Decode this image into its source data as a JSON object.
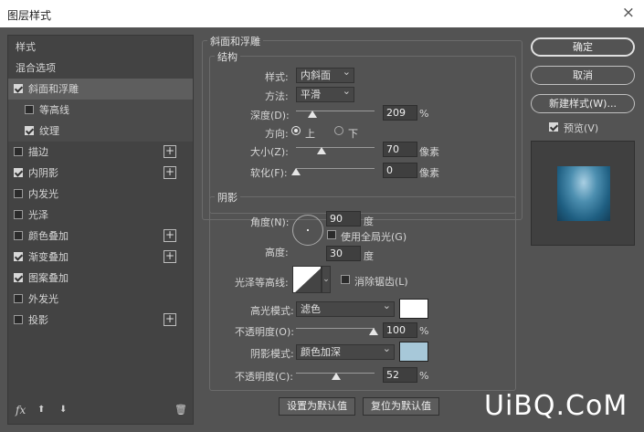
{
  "window": {
    "title": "图层样式",
    "close_glyph": "×"
  },
  "sidebar": {
    "items": [
      {
        "label": "样式",
        "checkbox": false,
        "checked": false,
        "plus": false,
        "indent": 0
      },
      {
        "label": "混合选项",
        "checkbox": false,
        "checked": false,
        "plus": false,
        "indent": 0
      },
      {
        "label": "斜面和浮雕",
        "checkbox": true,
        "checked": true,
        "plus": false,
        "indent": 0,
        "selected": true
      },
      {
        "label": "等高线",
        "checkbox": true,
        "checked": false,
        "plus": false,
        "indent": 1
      },
      {
        "label": "纹理",
        "checkbox": true,
        "checked": true,
        "plus": false,
        "indent": 1
      },
      {
        "label": "描边",
        "checkbox": true,
        "checked": false,
        "plus": true,
        "indent": 0
      },
      {
        "label": "内阴影",
        "checkbox": true,
        "checked": true,
        "plus": true,
        "indent": 0
      },
      {
        "label": "内发光",
        "checkbox": true,
        "checked": false,
        "plus": false,
        "indent": 0
      },
      {
        "label": "光泽",
        "checkbox": true,
        "checked": false,
        "plus": false,
        "indent": 0
      },
      {
        "label": "颜色叠加",
        "checkbox": true,
        "checked": false,
        "plus": true,
        "indent": 0
      },
      {
        "label": "渐变叠加",
        "checkbox": true,
        "checked": true,
        "plus": true,
        "indent": 0
      },
      {
        "label": "图案叠加",
        "checkbox": true,
        "checked": true,
        "plus": false,
        "indent": 0
      },
      {
        "label": "外发光",
        "checkbox": true,
        "checked": false,
        "plus": false,
        "indent": 0
      },
      {
        "label": "投影",
        "checkbox": true,
        "checked": false,
        "plus": true,
        "indent": 0
      }
    ],
    "fx_label": "fx",
    "up_glyph": "⬆",
    "down_glyph": "⬇",
    "trash_glyph": "🗑"
  },
  "bevel": {
    "section_title": "斜面和浮雕",
    "structure_title": "结构",
    "style_label": "样式:",
    "style_value": "内斜面",
    "technique_label": "方法:",
    "technique_value": "平滑",
    "depth_label": "深度(D):",
    "depth_value": "209",
    "depth_unit": "%",
    "depth_fraction": 0.209,
    "direction_label": "方向:",
    "direction_up": "上",
    "direction_down": "下",
    "size_label": "大小(Z):",
    "size_value": "70",
    "size_unit": "像素",
    "size_fraction": 0.28,
    "soften_label": "软化(F):",
    "soften_value": "0",
    "soften_unit": "像素",
    "soften_fraction": 0.0
  },
  "shading": {
    "title": "阴影",
    "angle_label": "角度(N):",
    "angle_value": "90",
    "angle_unit": "度",
    "global_light_label": "使用全局光(G)",
    "altitude_label": "高度:",
    "altitude_value": "30",
    "altitude_unit": "度",
    "gloss_contour_label": "光泽等高线:",
    "anti_alias_label": "消除锯齿(L)",
    "highlight_mode_label": "高光模式:",
    "highlight_mode_value": "滤色",
    "highlight_color": "#ffffff",
    "highlight_opacity_label": "不透明度(O):",
    "highlight_opacity_value": "100",
    "highlight_opacity_fraction": 1.0,
    "shadow_mode_label": "阴影模式:",
    "shadow_mode_value": "颜色加深",
    "shadow_color": "#a7c8d9",
    "shadow_opacity_label": "不透明度(C):",
    "shadow_opacity_value": "52",
    "shadow_opacity_fraction": 0.52,
    "percent_unit": "%"
  },
  "footer": {
    "make_default": "设置为默认值",
    "reset_default": "复位为默认值"
  },
  "right": {
    "ok": "确定",
    "cancel": "取消",
    "new_style": "新建样式(W)...",
    "preview_label": "预览(V)",
    "preview_checked": true
  },
  "watermark": "UiBQ.CoM"
}
